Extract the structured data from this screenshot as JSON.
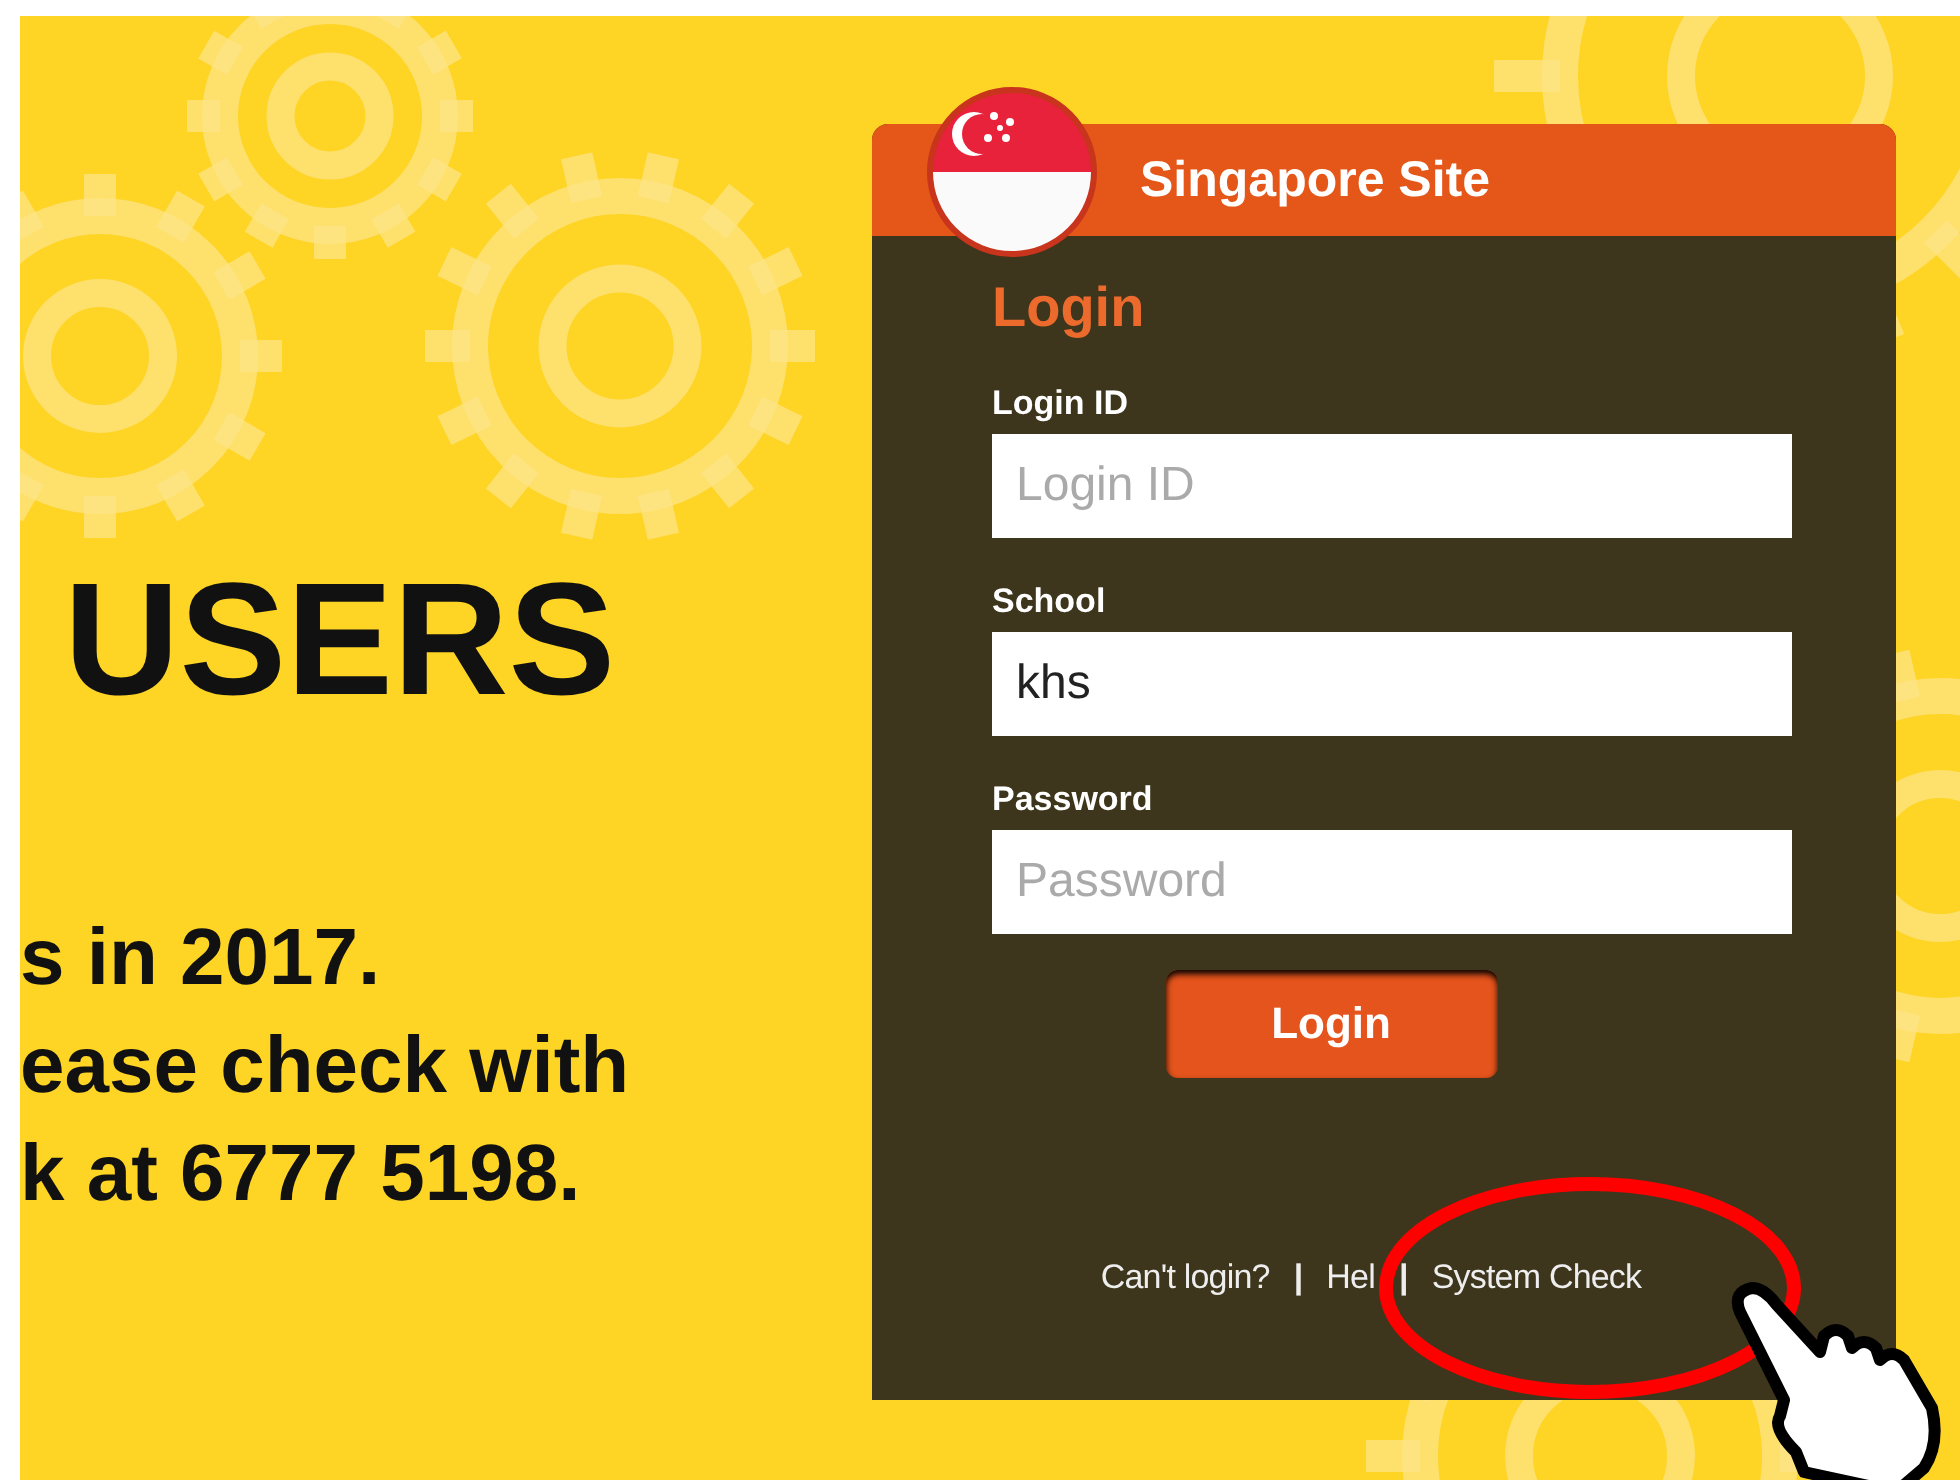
{
  "banner": {
    "heading": "USERS",
    "lines": [
      "s in 2017.",
      "ease check with",
      "k at 6777 5198."
    ]
  },
  "login_panel": {
    "site_title": "Singapore Site",
    "title": "Login",
    "fields": [
      {
        "label": "Login ID",
        "placeholder": "Login ID"
      },
      {
        "label": "School",
        "value": "khs"
      },
      {
        "label": "Password",
        "placeholder": "Password"
      }
    ],
    "button": "Login",
    "links": [
      {
        "kind": "link",
        "text": "Can't login?"
      },
      {
        "kind": "sep",
        "text": "|"
      },
      {
        "kind": "link",
        "text": "Hel"
      },
      {
        "kind": "sep",
        "text": "|"
      },
      {
        "kind": "link",
        "text": "System Check"
      }
    ]
  }
}
